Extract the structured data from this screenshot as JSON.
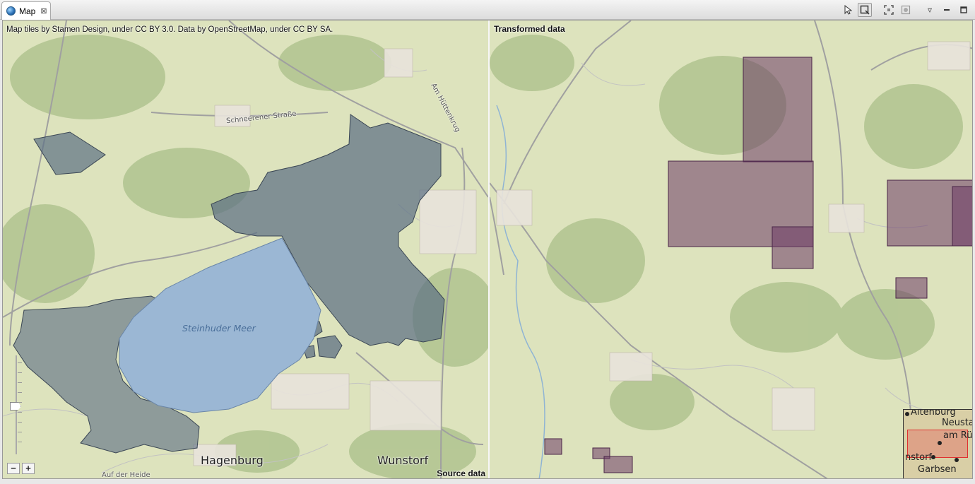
{
  "window": {
    "tab_label": "Map",
    "tab_close": "⊠"
  },
  "toolbar": {
    "pointer_icon": "pointer-icon",
    "select_icon": "selection-icon",
    "zoom_extent_icon": "zoom-extent-icon",
    "sync_icon": "sync-icon",
    "menu_icon": "▿",
    "minimize_icon": "▭",
    "maximize_icon": "□"
  },
  "left_pane": {
    "attribution": "Map tiles by Stamen Design, under CC BY 3.0. Data by OpenStreetMap, under CC BY SA.",
    "label": "Source data",
    "places": {
      "lake": "Steinhuder Meer",
      "town1": "Hagenburg",
      "town2": "Wunstorf",
      "street1": "Schneerener Straße",
      "street2": "Am Hüttenkrug",
      "street3": "Auf der Heide"
    },
    "zoom_out": "−",
    "zoom_in": "+"
  },
  "right_pane": {
    "label": "Transformed data",
    "overview": {
      "places": [
        "Altenburg",
        "Neustadt",
        "am Rü",
        "nstorf",
        "Garbsen"
      ]
    }
  },
  "colors": {
    "source_polygon": "#5d7084",
    "lake": "#9bb7d4",
    "transformed_polygon": "#6b3a66",
    "base_map": "#dde3bd"
  }
}
